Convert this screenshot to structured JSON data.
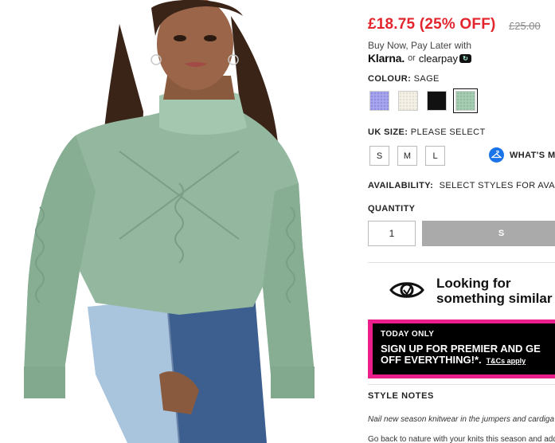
{
  "product": {
    "image_alt": "Model wearing sage cable knit roll neck jumper with two-tone jeans",
    "price_now": "£18.75 (25% OFF)",
    "price_was": "£25.00"
  },
  "payment": {
    "buy_now_text": "Buy Now, Pay Later with",
    "klarna": "Klarna.",
    "or": "or",
    "clearpay": "clearpay"
  },
  "colour": {
    "label": "COLOUR:",
    "value": "SAGE",
    "swatches": [
      {
        "name": "lilac",
        "color": "#a9a6ef"
      },
      {
        "name": "cream",
        "color": "#f4f1e6"
      },
      {
        "name": "black",
        "color": "#111111"
      },
      {
        "name": "sage",
        "color": "#a6cdb2",
        "selected": true
      }
    ]
  },
  "size": {
    "label": "UK SIZE:",
    "value": "PLEASE SELECT",
    "options": [
      "S",
      "M",
      "L"
    ],
    "fit_help": "WHAT'S M"
  },
  "availability": {
    "label": "AVAILABILITY:",
    "value": "SELECT STYLES FOR AVAILA"
  },
  "quantity": {
    "label": "QUANTITY",
    "value": "1"
  },
  "add_button": "S",
  "similar": {
    "line1": "Looking for",
    "line2": "something similar"
  },
  "promo": {
    "kicker": "TODAY ONLY",
    "line1": "SIGN UP FOR PREMIER AND GE",
    "line2": "OFF EVERYTHING!*.",
    "tc": "T&Cs apply"
  },
  "style_notes": {
    "heading": "STYLE NOTES",
    "line1": "Nail new season knitwear in the jumpers and cardiga",
    "line2": "Go back to nature with your knits this season and add"
  },
  "colors": {
    "price_red": "#e3262d",
    "promo_pink": "#ec1e8c",
    "fit_blue": "#1a73e8"
  }
}
